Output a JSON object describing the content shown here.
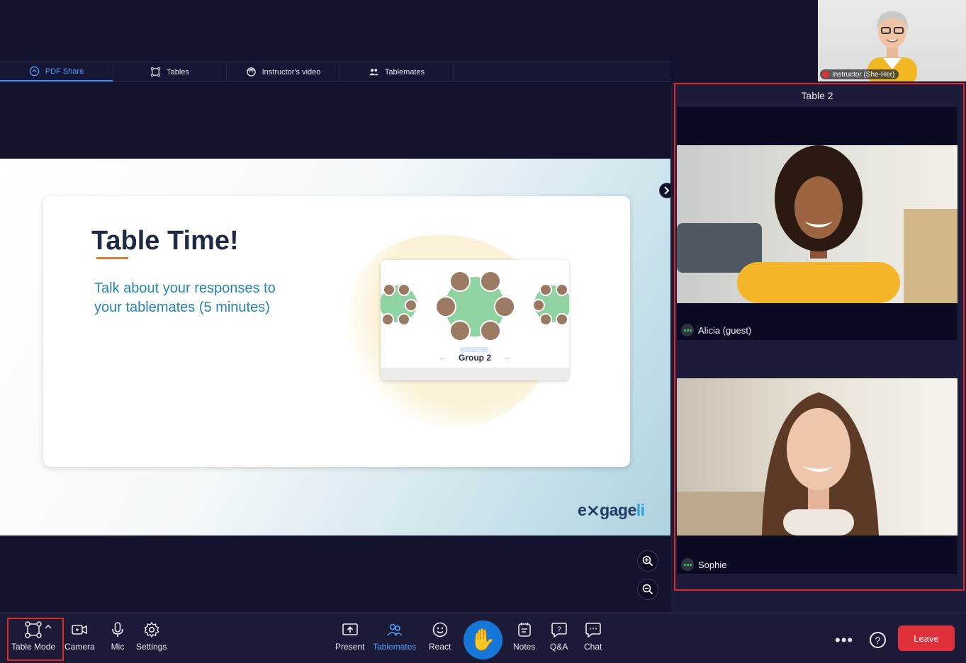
{
  "tabs": [
    {
      "label": "PDF Share",
      "icon": "pdf-share-icon"
    },
    {
      "label": "Tables",
      "icon": "tables-icon"
    },
    {
      "label": "Instructor's video",
      "icon": "instructor-face-icon"
    },
    {
      "label": "Tablemates",
      "icon": "people-icon"
    }
  ],
  "instructor": {
    "label": "Instructor (She-Her)"
  },
  "slide": {
    "title": "Table Time!",
    "body": "Talk about your responses to your tablemates (5 minutes)",
    "mini_group_label": "Group 2",
    "logo_main": "e⨯gage",
    "logo_accent": "li"
  },
  "panel": {
    "title": "Table 2",
    "participants": [
      {
        "name": "Alicia (guest)"
      },
      {
        "name": "Sophie"
      }
    ]
  },
  "toolbar": {
    "table_mode": "Table Mode",
    "camera": "Camera",
    "mic": "Mic",
    "settings": "Settings",
    "present": "Present",
    "tablemates": "Tablemates",
    "react": "React",
    "notes": "Notes",
    "qa": "Q&A",
    "chat": "Chat",
    "more": "•••",
    "help": "?",
    "leave": "Leave"
  },
  "colors": {
    "accent": "#4da3ff",
    "leave": "#e0313b",
    "highlight": "#e02a2a",
    "hand": "#1677d8"
  }
}
